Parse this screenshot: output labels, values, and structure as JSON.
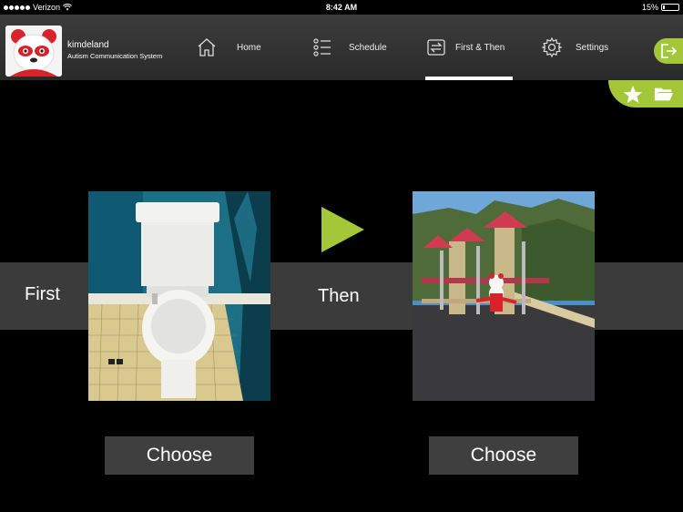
{
  "status_bar": {
    "carrier": "Verizon",
    "time": "8:42 AM",
    "battery": "15%",
    "battery_level": 0.15
  },
  "header": {
    "brand_name": "kimdeland",
    "brand_subtitle": "Autism Communication System",
    "nav": [
      {
        "label": "Home",
        "icon": "home-icon"
      },
      {
        "label": "Schedule",
        "icon": "list-icon"
      },
      {
        "label": "First & Then",
        "icon": "repeat-icon",
        "active": true
      },
      {
        "label": "Settings",
        "icon": "gear-icon"
      }
    ]
  },
  "tray": {
    "icons": [
      "star-icon",
      "folder-icon"
    ]
  },
  "board": {
    "first_label": "First",
    "then_label": "Then",
    "arrow_icon": "play-arrow-icon",
    "first_image": "toilet-photo",
    "then_image": "playground-photo",
    "choose_first": "Choose",
    "choose_then": "Choose"
  },
  "colors": {
    "accent": "#a3c739",
    "band": "#3b3b3b",
    "nav_bg": "#333333"
  }
}
